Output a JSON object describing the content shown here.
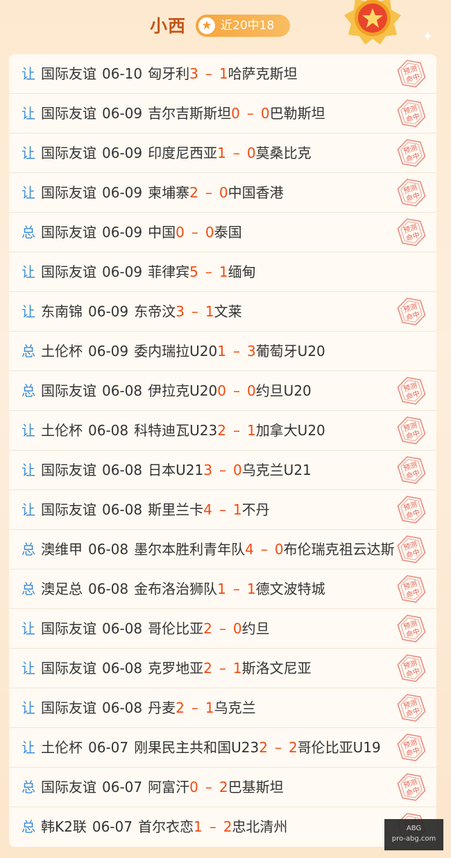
{
  "header": {
    "author": "小西",
    "badge": "近20中18"
  },
  "stamp_text": [
    "预测",
    "命中"
  ],
  "watermark": {
    "line1": "ABG",
    "line2": "pro-abg.com"
  },
  "rows": [
    {
      "type": "让",
      "league": "国际友谊",
      "date": "06-10",
      "home": "匈牙利",
      "hs": "3",
      "as": "1",
      "away": "哈萨克斯坦",
      "hit": true
    },
    {
      "type": "让",
      "league": "国际友谊",
      "date": "06-09",
      "home": "吉尔吉斯斯坦",
      "hs": "0",
      "as": "0",
      "away": "巴勒斯坦",
      "hit": true
    },
    {
      "type": "让",
      "league": "国际友谊",
      "date": "06-09",
      "home": "印度尼西亚",
      "hs": "1",
      "as": "0",
      "away": "莫桑比克",
      "hit": true
    },
    {
      "type": "让",
      "league": "国际友谊",
      "date": "06-09",
      "home": "柬埔寨",
      "hs": "2",
      "as": "0",
      "away": "中国香港",
      "hit": true
    },
    {
      "type": "总",
      "league": "国际友谊",
      "date": "06-09",
      "home": "中国",
      "hs": "0",
      "as": "0",
      "away": "泰国",
      "hit": true
    },
    {
      "type": "让",
      "league": "国际友谊",
      "date": "06-09",
      "home": "菲律宾",
      "hs": "5",
      "as": "1",
      "away": "缅甸",
      "hit": false
    },
    {
      "type": "让",
      "league": "东南锦",
      "date": "06-09",
      "home": "东帝汶",
      "hs": "3",
      "as": "1",
      "away": "文莱",
      "hit": true
    },
    {
      "type": "总",
      "league": "土伦杯",
      "date": "06-09",
      "home": "委内瑞拉U20",
      "hs": "1",
      "as": "3",
      "away": "葡萄牙U20",
      "hit": false
    },
    {
      "type": "总",
      "league": "国际友谊",
      "date": "06-08",
      "home": "伊拉克U20",
      "hs": "0",
      "as": "0",
      "away": "约旦U20",
      "hit": true
    },
    {
      "type": "让",
      "league": "土伦杯",
      "date": "06-08",
      "home": "科特迪瓦U23",
      "hs": "2",
      "as": "1",
      "away": "加拿大U20",
      "hit": true
    },
    {
      "type": "让",
      "league": "国际友谊",
      "date": "06-08",
      "home": "日本U21",
      "hs": "3",
      "as": "0",
      "away": "乌克兰U21",
      "hit": true
    },
    {
      "type": "让",
      "league": "国际友谊",
      "date": "06-08",
      "home": "斯里兰卡",
      "hs": "4",
      "as": "1",
      "away": "不丹",
      "hit": true
    },
    {
      "type": "总",
      "league": "澳维甲",
      "date": "06-08",
      "home": "墨尔本胜利青年队",
      "hs": "4",
      "as": "0",
      "away": "布伦瑞克祖云达斯",
      "hit": true
    },
    {
      "type": "总",
      "league": "澳足总",
      "date": "06-08",
      "home": "金布洛治狮队",
      "hs": "1",
      "as": "1",
      "away": "德文波特城",
      "hit": true
    },
    {
      "type": "让",
      "league": "国际友谊",
      "date": "06-08",
      "home": "哥伦比亚",
      "hs": "2",
      "as": "0",
      "away": "约旦",
      "hit": true
    },
    {
      "type": "让",
      "league": "国际友谊",
      "date": "06-08",
      "home": "克罗地亚",
      "hs": "2",
      "as": "1",
      "away": "斯洛文尼亚",
      "hit": true
    },
    {
      "type": "让",
      "league": "国际友谊",
      "date": "06-08",
      "home": "丹麦",
      "hs": "2",
      "as": "1",
      "away": "乌克兰",
      "hit": true
    },
    {
      "type": "让",
      "league": "土伦杯",
      "date": "06-07",
      "home": "刚果民主共和国U23",
      "hs": "2",
      "as": "2",
      "away": "哥伦比亚U19",
      "hit": true
    },
    {
      "type": "总",
      "league": "国际友谊",
      "date": "06-07",
      "home": "阿富汗",
      "hs": "0",
      "as": "2",
      "away": "巴基斯坦",
      "hit": true
    },
    {
      "type": "总",
      "league": "韩K2联",
      "date": "06-07",
      "home": "首尔衣恋",
      "hs": "1",
      "as": "2",
      "away": "忠北清州",
      "hit": true
    }
  ]
}
